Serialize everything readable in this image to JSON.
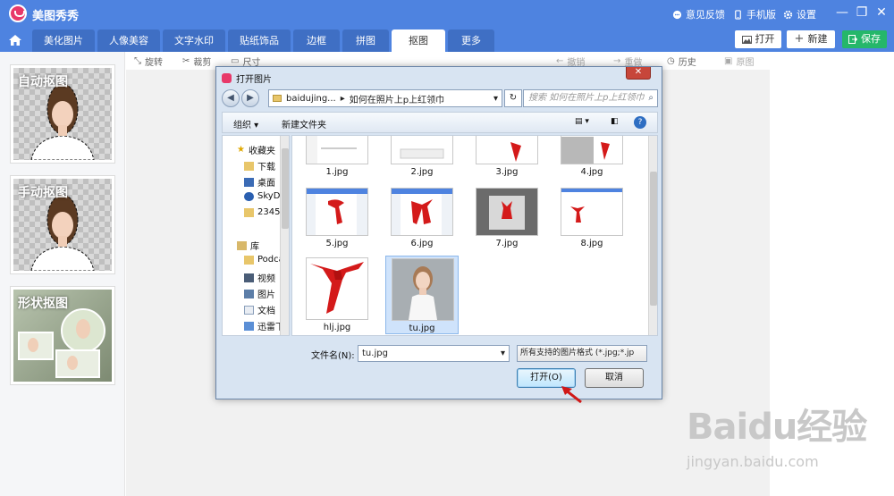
{
  "app": {
    "title": "美图秀秀",
    "feedback": "意见反馈",
    "mobile": "手机版",
    "settings": "设置"
  },
  "tabs": [
    "美化图片",
    "人像美容",
    "文字水印",
    "贴纸饰品",
    "边框",
    "拼图",
    "抠图",
    "更多"
  ],
  "active_tab": "抠图",
  "actions": {
    "open": "打开",
    "new": "新建",
    "save": "保存"
  },
  "toolbar": {
    "rotate": "旋转",
    "crop": "裁剪",
    "size": "尺寸",
    "undo": "撤销",
    "redo": "重做",
    "history": "历史",
    "original": "原图"
  },
  "cutout_cards": [
    "自动抠图",
    "手动抠图",
    "形状抠图"
  ],
  "dialog": {
    "title": "打开图片",
    "close": "✕",
    "breadcrumb": [
      "baidujing...",
      "如何在照片上p上红领巾"
    ],
    "search_placeholder": "搜索 如何在照片上p上红领巾",
    "organize": "组织 ▾",
    "new_folder": "新建文件夹",
    "nav_items": [
      "收藏夹",
      "下载",
      "桌面",
      "SkyDr",
      "2345I",
      "库",
      "Podca",
      "视频",
      "图片",
      "文档",
      "迅雷下"
    ],
    "files": [
      "1.jpg",
      "2.jpg",
      "3.jpg",
      "4.jpg",
      "5.jpg",
      "6.jpg",
      "7.jpg",
      "8.jpg",
      "hlj.jpg",
      "tu.jpg"
    ],
    "selected_file": "tu.jpg",
    "filename_label": "文件名(N):",
    "filename_value": "tu.jpg",
    "filetype": "所有支持的图片格式 (*.jpg;*.jp",
    "open_button": "打开(O)",
    "cancel_button": "取消"
  },
  "watermark": {
    "main": "Baidu经验",
    "sub": "jingyan.baidu.com"
  },
  "colors": {
    "header": "#4e83e0",
    "save": "#25b76a",
    "accent_red": "#e8396a"
  }
}
